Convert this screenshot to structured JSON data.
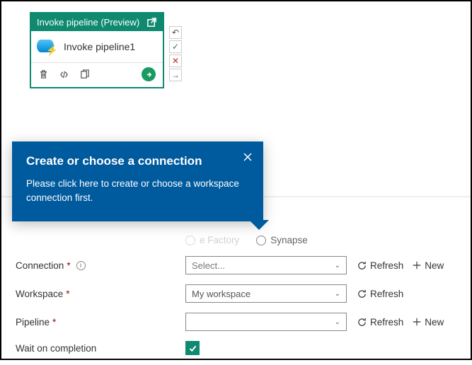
{
  "activity": {
    "header": "Invoke pipeline (Preview)",
    "name": "Invoke pipeline1"
  },
  "tooltip": {
    "title": "Create or choose a connection",
    "body": "Please click here to create or choose a workspace connection first."
  },
  "typeRadios": {
    "opt1_fragment": "e Factory",
    "opt2": "Synapse"
  },
  "form": {
    "connection_label": "Connection",
    "connection_placeholder": "Select...",
    "workspace_label": "Workspace",
    "workspace_value": "My workspace",
    "pipeline_label": "Pipeline",
    "pipeline_value": "",
    "wait_label": "Wait on completion",
    "wait_checked": true,
    "refresh": "Refresh",
    "new": "New"
  }
}
